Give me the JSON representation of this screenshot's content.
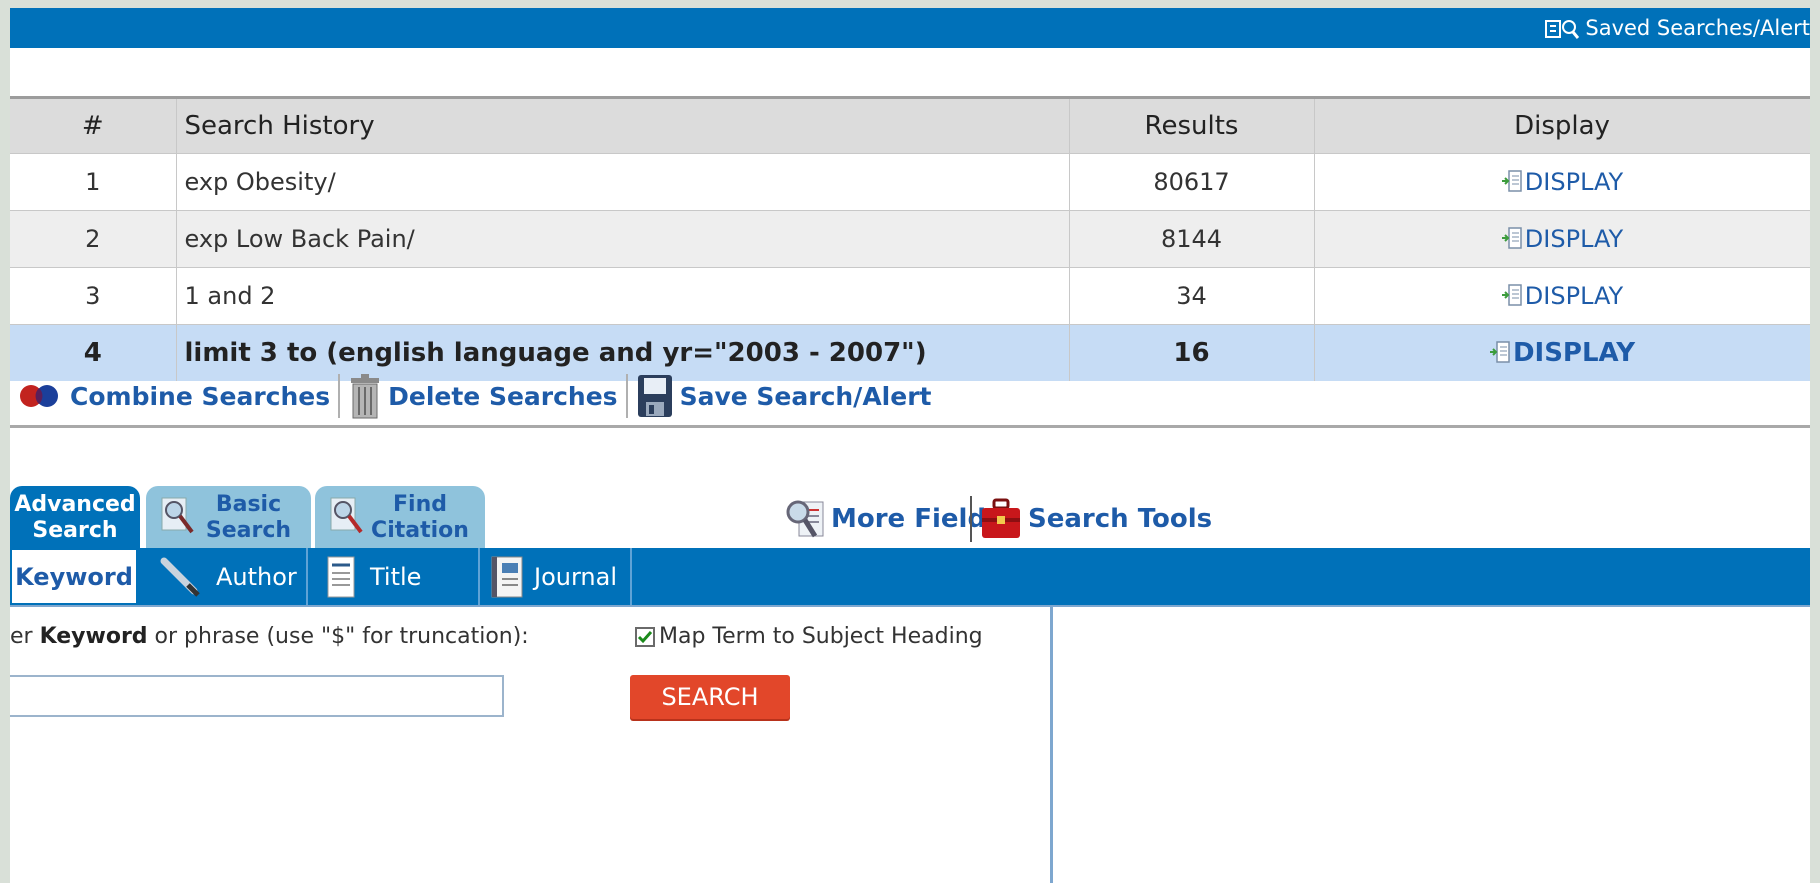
{
  "topbar": {
    "saved_searches_label": "Saved Searches/Alert"
  },
  "history": {
    "headers": {
      "num": "#",
      "history": "Search History",
      "results": "Results",
      "display": "Display"
    },
    "rows": [
      {
        "num": "1",
        "query": "exp Obesity/",
        "results": "80617",
        "display": "DISPLAY"
      },
      {
        "num": "2",
        "query": "exp Low Back Pain/",
        "results": "8144",
        "display": "DISPLAY"
      },
      {
        "num": "3",
        "query": "1 and 2",
        "results": "34",
        "display": "DISPLAY"
      },
      {
        "num": "4",
        "query": "limit 3 to (english language and yr=\"2003 - 2007\")",
        "results": "16",
        "display": "DISPLAY"
      }
    ]
  },
  "actions": {
    "combine": "Combine Searches",
    "delete": "Delete Searches",
    "save": "Save Search/Alert"
  },
  "tabs": {
    "advanced_line1": "Advanced",
    "advanced_line2": "Search",
    "basic_line1": "Basic",
    "basic_line2": "Search",
    "find_line1": "Find",
    "find_line2": "Citation"
  },
  "tools": {
    "more_fields": "More Fields",
    "search_tools": "Search Tools"
  },
  "subtabs": {
    "keyword": "Keyword",
    "author": "Author",
    "title": "Title",
    "journal": "Journal"
  },
  "form": {
    "keyword_prefix": "er ",
    "keyword_bold": "Keyword",
    "keyword_suffix": " or phrase (use \"$\" for truncation):",
    "keyword_value": "",
    "map_term_label": "Map Term to Subject Heading",
    "map_term_checked": true,
    "search_button": "SEARCH"
  }
}
